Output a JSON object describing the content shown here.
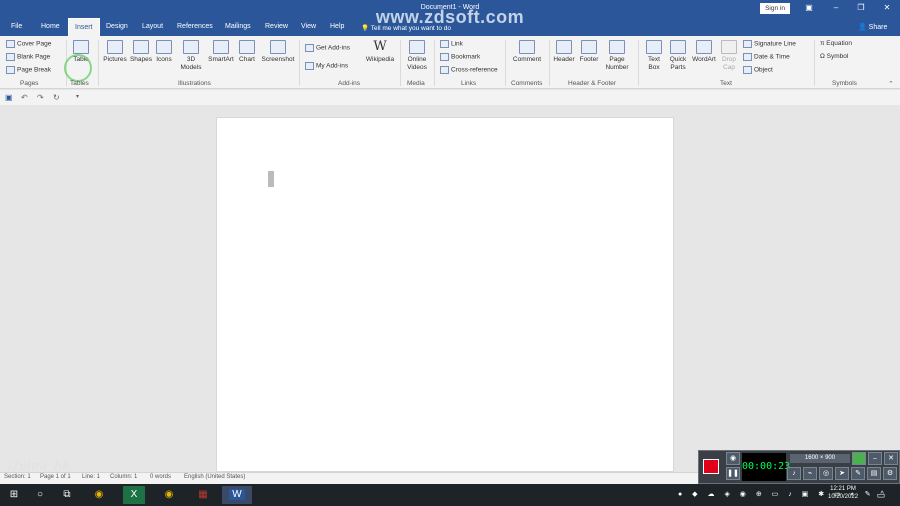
{
  "window": {
    "title": "Document1 - Word",
    "watermark": "www.zdsoft.com",
    "sign_in": "Sign in",
    "share": "Share",
    "min": "–",
    "restore": "❐",
    "close": "✕",
    "ribbon_display": "▣"
  },
  "tabs": [
    "File",
    "Home",
    "Insert",
    "Design",
    "Layout",
    "References",
    "Mailings",
    "Review",
    "View",
    "Help"
  ],
  "tell_me": "Tell me what you want to do",
  "ribbon": {
    "pages": {
      "cover_page": "Cover Page",
      "blank_page": "Blank Page",
      "page_break": "Page Break",
      "label": "Pages"
    },
    "tables": {
      "table": "Table",
      "label": "Tables"
    },
    "illustrations": {
      "pictures": "Pictures",
      "shapes": "Shapes",
      "icons": "Icons",
      "models_1": "3D",
      "models_2": "Models",
      "smartart": "SmartArt",
      "chart": "Chart",
      "screenshot": "Screenshot",
      "label": "Illustrations"
    },
    "addins": {
      "get": "Get Add-ins",
      "my": "My Add-ins",
      "wikipedia": "Wikipedia",
      "label": "Add-ins"
    },
    "media": {
      "online_1": "Online",
      "online_2": "Videos",
      "label": "Media"
    },
    "links": {
      "link": "Link",
      "bookmark": "Bookmark",
      "cross": "Cross-reference",
      "label": "Links"
    },
    "comments": {
      "comment": "Comment",
      "label": "Comments"
    },
    "hf": {
      "header": "Header",
      "footer": "Footer",
      "page_num_1": "Page",
      "page_num_2": "Number",
      "label": "Header & Footer"
    },
    "text": {
      "textbox_1": "Text",
      "textbox_2": "Box",
      "quick_1": "Quick",
      "quick_2": "Parts",
      "wordart": "WordArt",
      "drop_1": "Drop",
      "drop_2": "Cap",
      "sigline": "Signature Line",
      "datetime": "Date & Time",
      "object": "Object",
      "label": "Text"
    },
    "symbols": {
      "equation": "Equation",
      "symbol": "Symbol",
      "label": "Symbols"
    }
  },
  "status": {
    "section": "Section: 1",
    "page": "Page 1 of 1",
    "line": "Line: 1",
    "column": "Column: 1",
    "words": "0 words",
    "lang": "English (United States)"
  },
  "corner_watermark": "/Zehra_hk",
  "recorder": {
    "time": "00:00:23",
    "size": "1600 × 900"
  },
  "clock": {
    "time": "12:21 PM",
    "date": "10/20/2022"
  }
}
